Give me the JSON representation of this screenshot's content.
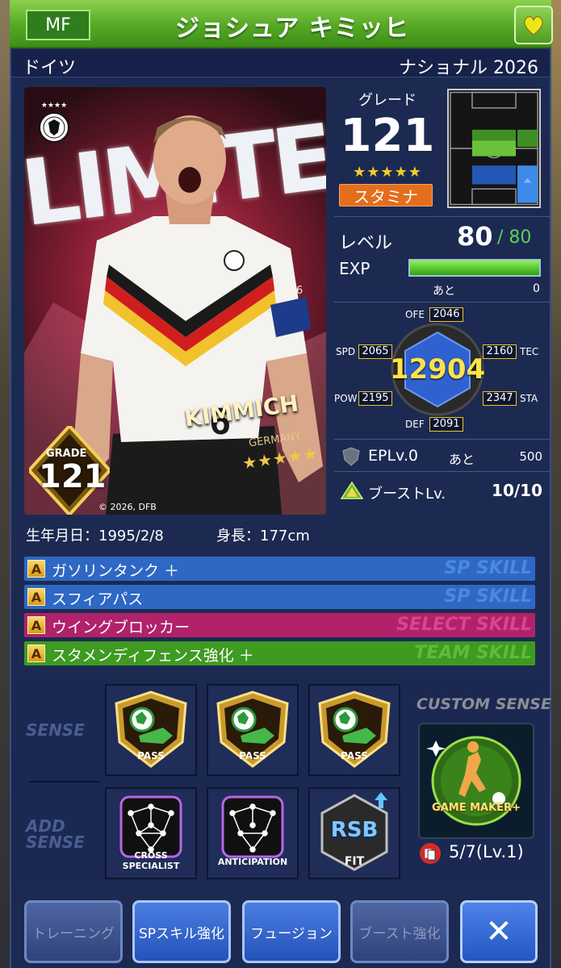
{
  "header": {
    "position": "MF",
    "player_name": "ジョシュア キミッヒ"
  },
  "subheader": {
    "country": "ドイツ",
    "series": "ナショナル 2026"
  },
  "card": {
    "limited": "LIMITED",
    "year": "2026",
    "name_on_card": "KIMMICH",
    "team_on_card": "GERMANY",
    "stars_on_card": "★★★★★",
    "grade_label": "GRADE",
    "grade_value": "121",
    "copyright": "© 2026, DFB",
    "shirt_number": "6"
  },
  "grade": {
    "title": "グレード",
    "value": "121",
    "stars": "★★★★★",
    "type": "スタミナ"
  },
  "level": {
    "label": "レベル",
    "current": "80",
    "max": "/ 80",
    "exp_label": "EXP",
    "exp_fill": 1.0,
    "exp_rest_label": "あと",
    "exp_rest_value": "0"
  },
  "stats": {
    "total": "12904",
    "ofe_label": "OFE",
    "ofe": "2046",
    "spd_label": "SPD",
    "spd": "2065",
    "tec_label": "TEC",
    "tec": "2160",
    "pow_label": "POW",
    "pow": "2195",
    "sta_label": "STA",
    "sta": "2347",
    "def_label": "DEF",
    "def": "2091"
  },
  "epl": {
    "label": "EPLv.0",
    "rest_label": "あと",
    "rest_value": "500"
  },
  "boost": {
    "label": "ブーストLv.",
    "value": "10/10"
  },
  "profile": {
    "birth": "生年月日：1995/2/8",
    "height": "身長：177cm"
  },
  "skills": [
    {
      "grade": "A",
      "name": "ガソリンタンク ＋",
      "type": "SP SKILL",
      "color": "#2e68c4",
      "type_color": "#4f8fe8"
    },
    {
      "grade": "A",
      "name": "スフィアパス",
      "type": "SP SKILL",
      "color": "#2e68c4",
      "type_color": "#4f8fe8"
    },
    {
      "grade": "A",
      "name": "ウイングブロッカー",
      "type": "SELECT SKILL",
      "color": "#b0226a",
      "type_color": "#e24a9a"
    },
    {
      "grade": "A",
      "name": "スタメンディフェンス強化 ＋",
      "type": "TEAM SKILL",
      "color": "#3f9a22",
      "type_color": "#64c23c"
    }
  ],
  "sense": {
    "sense_label": "SENSE",
    "add_sense_label": "ADD SENSE",
    "slots": [
      {
        "label": "PASS"
      },
      {
        "label": "PASS"
      },
      {
        "label": "PASS"
      }
    ],
    "add_slots": [
      {
        "label": "CROSS SPECIALIST"
      },
      {
        "label": "ANTICIPATION"
      },
      {
        "label": "RSB",
        "sub": "FIT"
      }
    ],
    "custom_title": "CUSTOM SENSE",
    "custom_name": "GAME MAKER+",
    "custom_count": "5/7(Lv.1)"
  },
  "buttons": {
    "training": "トレーニング",
    "sp_skill": "SPスキル強化",
    "fusion": "フュージョン",
    "boost": "ブースト強化",
    "close": "✕"
  },
  "icons": {
    "favorite": "heart-icon",
    "epl": "shield-icon",
    "boost": "pyramid-icon",
    "custom_count": "cards-icon"
  }
}
